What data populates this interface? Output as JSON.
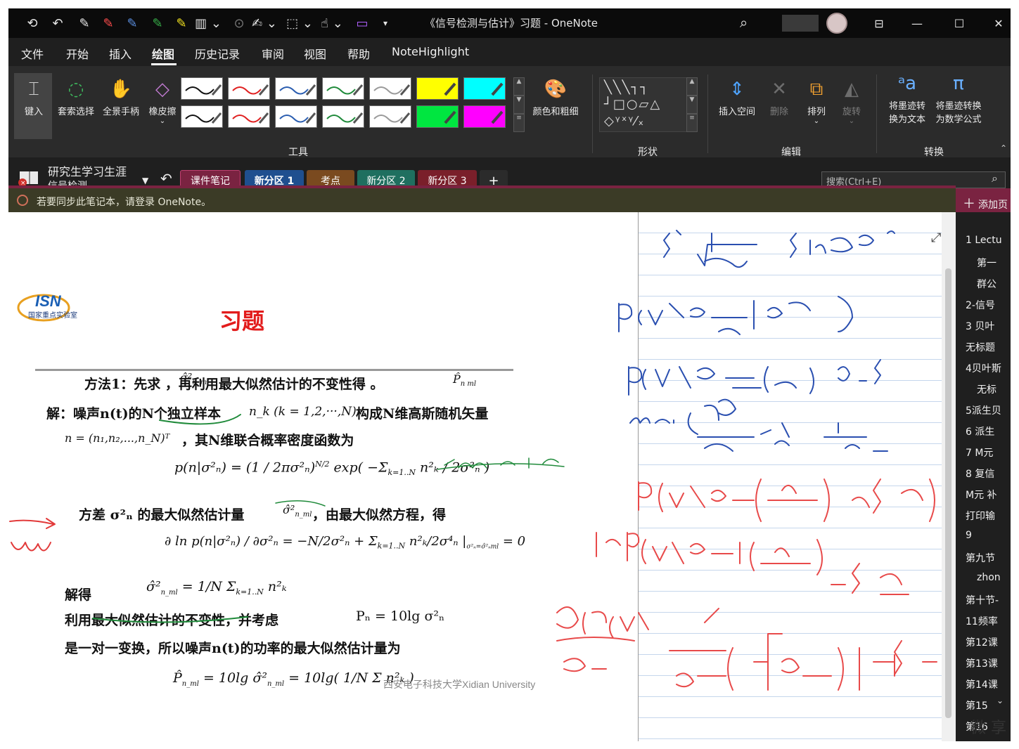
{
  "window": {
    "title": "《信号检测与估计》习题 - OneNote"
  },
  "menu": {
    "items": [
      "文件",
      "开始",
      "插入",
      "绘图",
      "历史记录",
      "审阅",
      "视图",
      "帮助",
      "NoteHighlight"
    ],
    "active": "绘图"
  },
  "ribbon": {
    "keyin": "键入",
    "lasso": "套索选择",
    "pan": "全景手柄",
    "eraser": "橡皮擦",
    "color_thickness": "颜色和粗细",
    "insert_space": "插入空间",
    "delete": "删除",
    "arrange": "排列",
    "rotate": "旋转",
    "ink_to_text_1": "将墨迹转",
    "ink_to_text_2": "换为文本",
    "ink_to_math_1": "将墨迹转换",
    "ink_to_math_2": "为数学公式",
    "groups": {
      "tools": "工具",
      "shapes": "形状",
      "edit": "编辑",
      "convert": "转换"
    },
    "pen_colors": [
      "#111111",
      "#e02020",
      "#2a5db0",
      "#1f8a3a",
      "#9a9a9a",
      "#ffff00",
      "#111111",
      "#e02020",
      "#2a5db0",
      "#1f8a3a",
      "#9a9a9a",
      "#00e640"
    ],
    "highlighters": [
      "#00ffff",
      "#ff00ff"
    ]
  },
  "notebook": {
    "name": "研究生学习生涯",
    "section_group": "信号检测",
    "tabs": [
      {
        "label": "课件笔记",
        "color": "#7a2341"
      },
      {
        "label": "新分区 1",
        "color": "#1f4f8f"
      },
      {
        "label": "考点",
        "color": "#7a4a1f"
      },
      {
        "label": "新分区 2",
        "color": "#1f6f5f"
      },
      {
        "label": "新分区 3",
        "color": "#7a1f2a"
      },
      {
        "label": "+",
        "color": "#2b2b2b"
      }
    ],
    "search_placeholder": "搜索(Ctrl+E)"
  },
  "notification": {
    "text": "若要同步此笔记本，请登录 OneNote。"
  },
  "pages": {
    "add_label": "添加页",
    "items": [
      "1 Lectu",
      "第一",
      "群公",
      "2-信号",
      "3 贝叶",
      "无标题",
      "4贝叶斯",
      "无标",
      "5派生贝",
      "6 派生",
      "7 M元",
      "8 复信",
      "M元 补",
      "打印输",
      "9",
      "第九节",
      "zhon",
      "第十节-",
      "11频率",
      "第12课",
      "第13课",
      "第14课",
      "第15",
      "第16"
    ]
  },
  "slide": {
    "logo_text": "ISN",
    "logo_sub": "国家重点实验室",
    "title": "习题",
    "line1": "方法1：先求        ，再利用最大似然估计的不变性得         。",
    "line2_a": "解：噪声n(t)的N个独立样本",
    "line2_math": "n_k (k = 1,2,···,N)",
    "line2_b": "构成N维高斯随机矢量",
    "line3": "，其N维联合概率密度函数为",
    "line4_a": "方差  σ²ₙ    的最大似然估计量",
    "line4_b": "，由最大似然方程，得",
    "line5": "解得",
    "line6_a": "利用最大似然估计的不变性，并考虑",
    "line6_math": "Pₙ = 10lg σ²ₙ",
    "line7": "是一对一变换，所以噪声n(t)的功率的最大似然估计量为",
    "univ": "西安电子科技大学Xidian University"
  },
  "watermark": "微 享"
}
